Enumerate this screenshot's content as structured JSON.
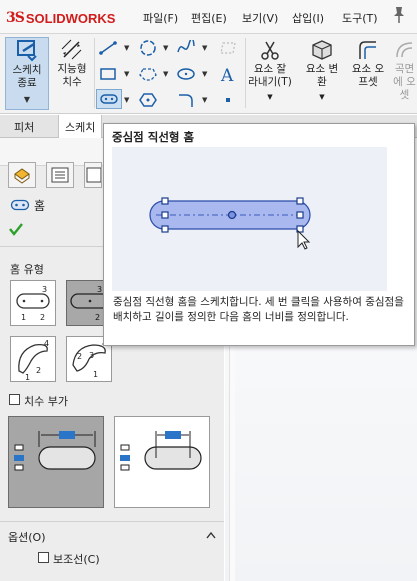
{
  "app": {
    "logo_text": "SOLIDWORKS",
    "brand_color": "#d21c1c"
  },
  "menubar": {
    "items": [
      "파일(F)",
      "편집(E)",
      "보기(V)",
      "삽입(I)",
      "도구(T)"
    ],
    "pin_icon": "pushpin-icon"
  },
  "ribbon": {
    "exit_sketch_label": "스케치\n종료",
    "smart_dim_label": "지능형\n치수",
    "trim_label": "요소 잘\n라내기(T)",
    "convert_label": "요소 변\n환",
    "offset_label": "요소 오\n프셋",
    "surface_label": "곡면\n에 오\n셋",
    "active_tool_color": "#cde0f2"
  },
  "tabs": [
    "피처",
    "스케치"
  ],
  "pm": {
    "title": "홈",
    "slot_type_label": "홈 유형",
    "add_dim_label": "치수 부가",
    "options_label": "옵션(O)",
    "construction_label": "보조선(C)"
  },
  "tooltip": {
    "title": "중심점 직선형 홈",
    "description": "중심점 직선형 홈을 스케치합니다. 세 번 클릭을 사용하여 중심점을 배치하고 길이를 정의한 다음 홈의 너비를 정의합니다.",
    "slot_fill_color": "#a9b8ee",
    "handle_color": "#1a3c8c"
  }
}
